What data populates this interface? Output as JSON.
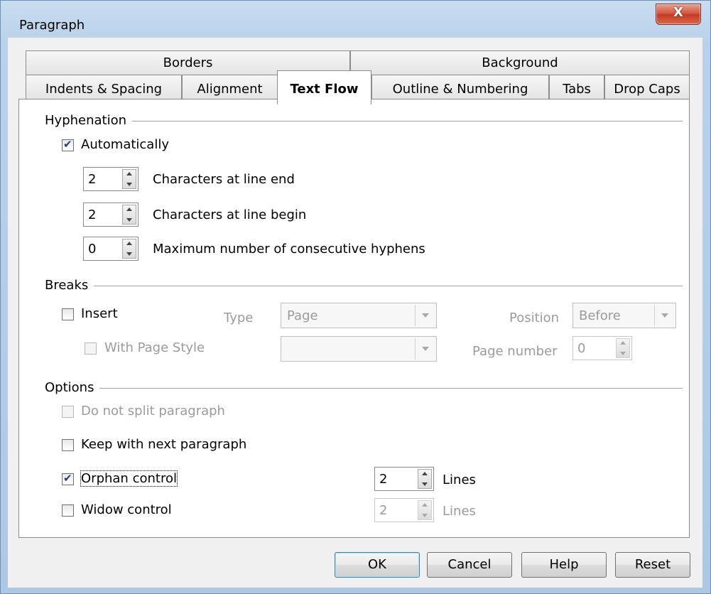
{
  "window": {
    "title": "Paragraph",
    "close_glyph": "X"
  },
  "tabs": {
    "row1": [
      "Borders",
      "Background"
    ],
    "row2": [
      "Indents & Spacing",
      "Alignment",
      "Text Flow",
      "Outline & Numbering",
      "Tabs",
      "Drop Caps"
    ],
    "active": "Text Flow"
  },
  "hyphenation": {
    "title": "Hyphenation",
    "automatically": {
      "label": "Automatically",
      "checked": true
    },
    "line_end": {
      "value": "2",
      "label": "Characters at line end"
    },
    "line_begin": {
      "value": "2",
      "label": "Characters at line begin"
    },
    "max_hyphens": {
      "value": "0",
      "label": "Maximum number of consecutive hyphens"
    }
  },
  "breaks": {
    "title": "Breaks",
    "insert": {
      "label": "Insert",
      "checked": false
    },
    "type_label": "Type",
    "type_value": "Page",
    "position_label": "Position",
    "position_value": "Before",
    "with_page_style": {
      "label": "With Page Style",
      "checked": false
    },
    "page_style_value": "",
    "page_number_label": "Page number",
    "page_number_value": "0"
  },
  "options": {
    "title": "Options",
    "do_not_split": {
      "label": "Do not split paragraph",
      "checked": false
    },
    "keep_with_next": {
      "label": "Keep with next paragraph",
      "checked": false
    },
    "orphan": {
      "label": "Orphan control",
      "checked": true,
      "lines": "2",
      "lines_label": "Lines"
    },
    "widow": {
      "label": "Widow control",
      "checked": false,
      "lines": "2",
      "lines_label": "Lines"
    }
  },
  "buttons": {
    "ok": "OK",
    "cancel": "Cancel",
    "help": "Help",
    "reset": "Reset"
  }
}
